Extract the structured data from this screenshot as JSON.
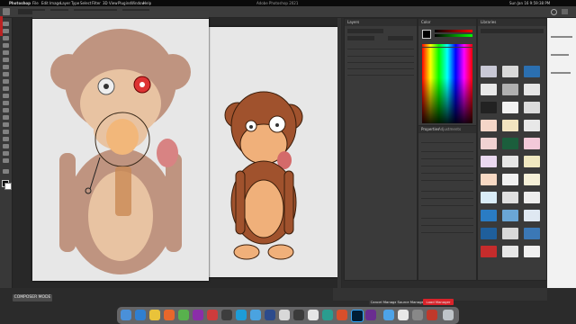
{
  "menubar": {
    "apple_icon": "apple-icon",
    "app_name": "Photoshop",
    "items": [
      "File",
      "Edit",
      "Image",
      "Layer",
      "Type",
      "Select",
      "Filter",
      "3D",
      "View",
      "Plugins",
      "Window",
      "Help"
    ],
    "window_title": "Adobe Photoshop 2021",
    "clock": "Sun Jan 16  9:59:38 PM"
  },
  "panels": {
    "layers_tab": "Layers",
    "color_tab": "Color",
    "swatches_tab": "Swatches",
    "properties_tab": "Properties",
    "adjustments_tab": "Adjustments",
    "libraries_tab": "Libraries"
  },
  "bottom_buttons": {
    "composer_mode": "COMPOSER MODE",
    "b1": "Cancel Manager",
    "b2": "Source Manager",
    "b3": "Load Manager"
  },
  "colors": {
    "accent_red": "#d9232a",
    "panel_bg": "#3a3a3a"
  }
}
